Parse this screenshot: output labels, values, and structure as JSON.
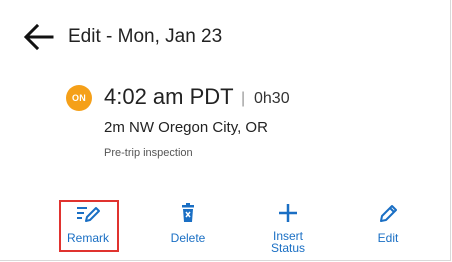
{
  "header": {
    "title": "Edit - Mon, Jan 23",
    "back_icon": "arrow-left-icon"
  },
  "event": {
    "badge": "ON",
    "badge_color": "#f5a019",
    "time": "4:02 am PDT",
    "separator": "|",
    "duration": "0h30",
    "location": "2m NW Oregon City, OR",
    "note": "Pre-trip inspection"
  },
  "actions": [
    {
      "label": "Remark",
      "icon": "remark-pencil-icon",
      "highlighted": true
    },
    {
      "label": "Delete",
      "icon": "trash-icon"
    },
    {
      "label": "Insert\nStatus",
      "icon": "plus-icon"
    },
    {
      "label": "Edit",
      "icon": "pencil-icon"
    }
  ],
  "colors": {
    "accent": "#1a6fc4",
    "highlight": "#e0332f"
  }
}
